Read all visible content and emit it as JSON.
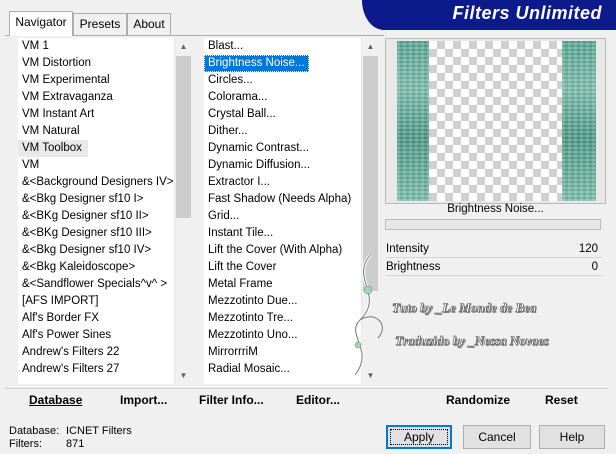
{
  "tabs": [
    {
      "label": "Navigator",
      "active": true
    },
    {
      "label": "Presets",
      "active": false
    },
    {
      "label": "About",
      "active": false
    }
  ],
  "brand": {
    "title": "Filters Unlimited",
    "color": "#0d1a8c"
  },
  "categories": {
    "items": [
      "VM 1",
      "VM Distortion",
      "VM Experimental",
      "VM Extravaganza",
      "VM Instant Art",
      "VM Natural",
      "VM Toolbox",
      "VM",
      "&<Background Designers IV>",
      "&<Bkg Designer sf10 I>",
      "&<BKg Designer sf10 II>",
      "&<BKg Designer sf10 III>",
      "&<Bkg Designer sf10 IV>",
      "&<Bkg Kaleidoscope>",
      "&<Sandflower Specials^v^ >",
      "[AFS IMPORT]",
      "Alf's Border FX",
      "Alf's Power Sines",
      "Andrew's Filters 22",
      "Andrew's Filters 27"
    ],
    "hovered_index": 6
  },
  "filters": {
    "items": [
      "Blast...",
      "Brightness Noise...",
      "Circles...",
      "Colorama...",
      "Crystal Ball...",
      "Dither...",
      "Dynamic Contrast...",
      "Dynamic Diffusion...",
      "Extractor I...",
      "Fast Shadow (Needs Alpha)",
      "Grid...",
      "Instant Tile...",
      "Lift the Cover (With Alpha)",
      "Lift the Cover",
      "Metal Frame",
      "Mezzotinto Due...",
      "Mezzotinto Tre...",
      "Mezzotinto Uno...",
      "MirrorrriM",
      "Radial Mosaic..."
    ],
    "selected_index": 1,
    "selection_color": "#0078d7"
  },
  "preview": {
    "caption": "Brightness Noise...",
    "strip_color": "#5aa996"
  },
  "params": [
    {
      "label": "Intensity",
      "value": "120"
    },
    {
      "label": "Brightness",
      "value": "0"
    }
  ],
  "watermark": {
    "line1": "Tuto by _Le Monde de Bea",
    "line2": "Traduzido by _Nessa Novaes"
  },
  "actions": {
    "database": "Database",
    "import": "Import...",
    "filter_info": "Filter Info...",
    "editor": "Editor...",
    "randomize": "Randomize",
    "reset": "Reset"
  },
  "footer": {
    "database_label": "Database:",
    "database_value": "ICNET Filters",
    "filters_label": "Filters:",
    "filters_value": "871"
  },
  "buttons": {
    "apply": "Apply",
    "cancel": "Cancel",
    "help": "Help"
  }
}
